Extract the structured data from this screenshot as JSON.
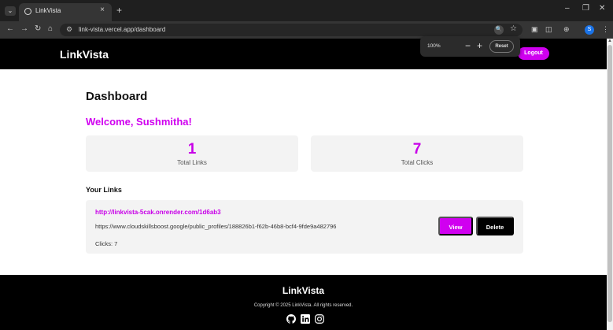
{
  "browser": {
    "tab_title": "LinkVista",
    "url": "link-vista.vercel.app/dashboard",
    "profile_initial": "S"
  },
  "zoom": {
    "level": "100%",
    "reset_label": "Reset"
  },
  "navbar": {
    "brand": "LinkVista",
    "logout_label": "Logout"
  },
  "main": {
    "title": "Dashboard",
    "welcome": "Welcome, Sushmitha!",
    "stats": [
      {
        "value": "1",
        "label": "Total Links"
      },
      {
        "value": "7",
        "label": "Total Clicks"
      }
    ],
    "links_heading": "Your Links",
    "links": [
      {
        "short_url": "http://linkvista-5cak.onrender.com/1d6ab3",
        "original_url": "https://www.cloudskillsboost.google/public_profiles/188826b1-f62b-46b8-bcf4-9fde9a482796",
        "clicks_text": "Clicks: 7",
        "view_label": "View",
        "delete_label": "Delete"
      }
    ]
  },
  "footer": {
    "brand": "LinkVista",
    "copyright": "Copyright © 2025 LinkVista. All rights reserved.",
    "social_icons": [
      "github-icon",
      "linkedin-icon",
      "instagram-icon"
    ]
  },
  "colors": {
    "accent": "#d000f0",
    "nav_bg": "#000000",
    "card_bg": "#f3f3f3"
  }
}
